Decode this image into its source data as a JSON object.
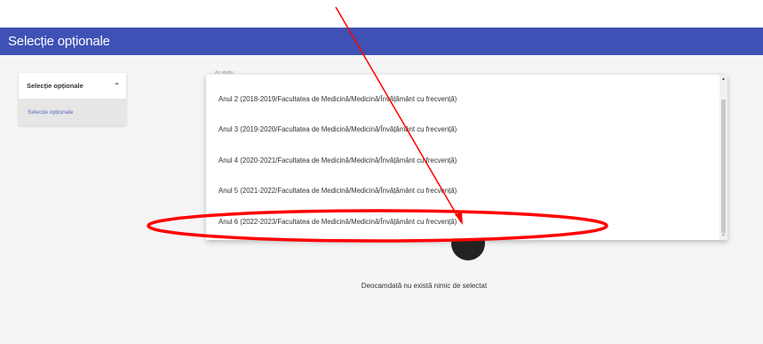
{
  "header": {
    "title": "Selecție opționale"
  },
  "sidebar": {
    "section_label": "Selecție opționale",
    "chevron": "chevron-up-icon",
    "sub_item": "Selecție opționale"
  },
  "select": {
    "label": "An studiu"
  },
  "dropdown": {
    "options": [
      "Anul 2 (2018-2019/Facultatea de Medicină/Medicină/Învățământ cu frecvență)",
      "Anul 3 (2019-2020/Facultatea de Medicină/Medicină/Învățământ cu frecvență)",
      "Anul 4 (2020-2021/Facultatea de Medicină/Medicină/Învățământ cu frecvență)",
      "Anul 5 (2021-2022/Facultatea de Medicină/Medicină/Învățământ cu frecvență)",
      "Anul 6 (2022-2023/Facultatea de Medicină/Medicină/Învățământ cu frecvență)"
    ]
  },
  "empty_state": {
    "text": "Deocamdată nu există nimic de selectat"
  },
  "colors": {
    "header": "#3f51b5",
    "annotation": "#ff0000",
    "link": "#5c6bc0"
  }
}
